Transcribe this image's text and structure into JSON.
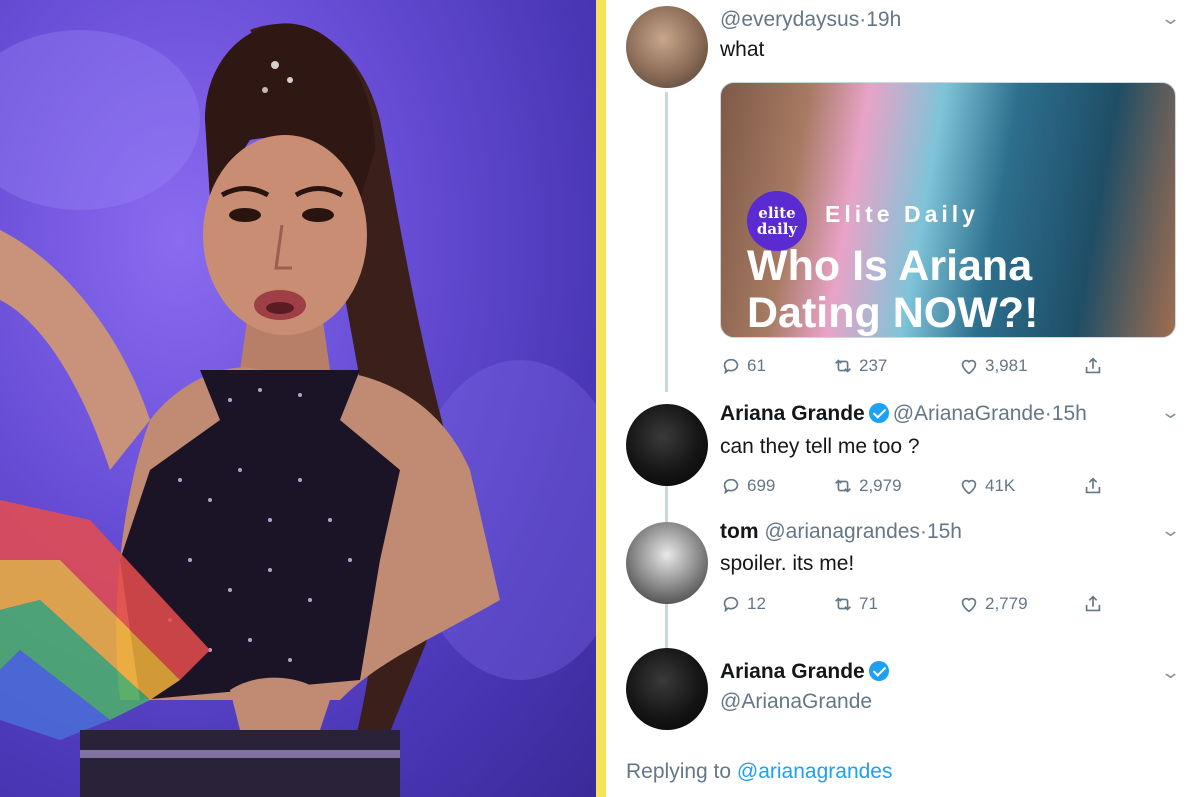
{
  "tweets": [
    {
      "handle": "@everydaysus",
      "time": "19h",
      "text": "what",
      "card": {
        "logo": "elite\ndaily",
        "brand": "Elite Daily",
        "headline": "Who Is Ariana Dating NOW?!"
      },
      "replies": "61",
      "retweets": "237",
      "likes": "3,981"
    },
    {
      "name": "Ariana Grande",
      "handle": "@ArianaGrande",
      "time": "15h",
      "text": "can they tell me too ?",
      "replies": "699",
      "retweets": "2,979",
      "likes": "41K"
    },
    {
      "name": "tom",
      "handle": "@arianagrandes",
      "time": "15h",
      "text": "spoiler. its me!",
      "replies": "12",
      "retweets": "71",
      "likes": "2,779"
    },
    {
      "name": "Ariana Grande",
      "handle": "@ArianaGrande"
    }
  ],
  "replying": {
    "prefix": "Replying to",
    "link": "@arianagrandes"
  },
  "colors": {
    "accent": "#1da1f2",
    "divider": "#f5e45a",
    "photo_bg": "#5b41c8"
  },
  "icons": [
    "reply-icon",
    "retweet-icon",
    "like-icon",
    "share-icon",
    "verified-icon",
    "chevron-down-icon"
  ]
}
